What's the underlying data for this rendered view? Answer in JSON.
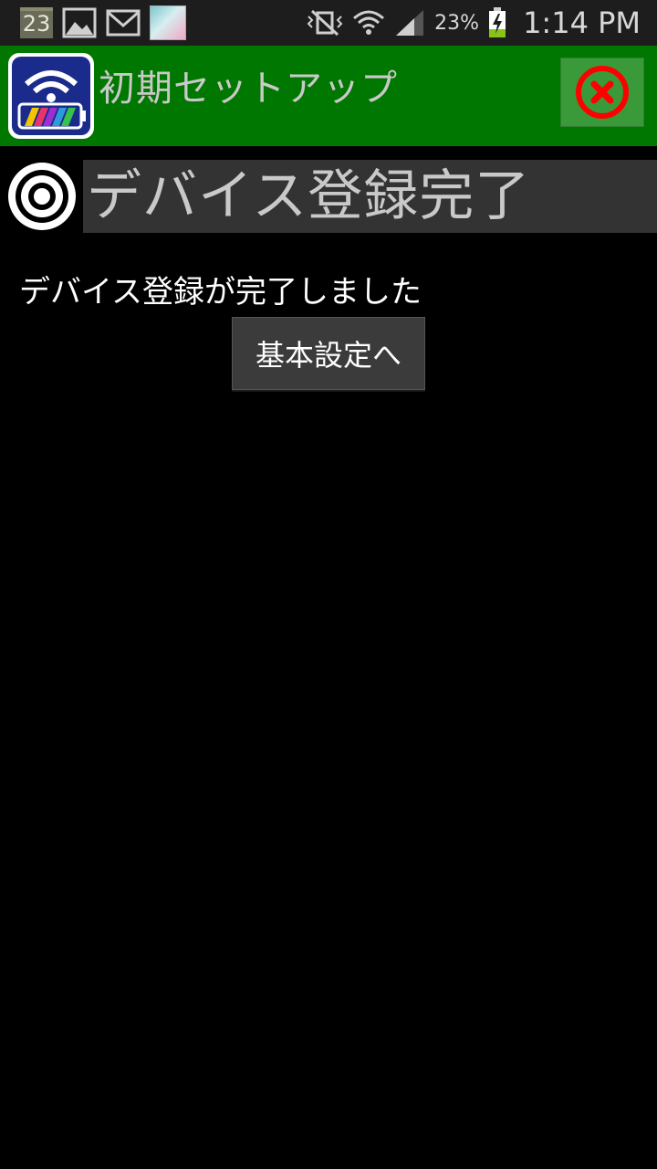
{
  "status_bar": {
    "notification_icons": [
      "calendar-icon",
      "gallery-icon",
      "gmail-icon",
      "app-thumbnail-icon"
    ],
    "calendar_day": "23",
    "battery_percent": "23%",
    "time": "1:14 PM",
    "system_icons": [
      "mute-vibrate-icon",
      "wifi-icon",
      "signal-icon",
      "battery-charging-icon"
    ]
  },
  "header": {
    "title": "初期セットアップ",
    "close_icon": "close-icon",
    "color": "#007700"
  },
  "section": {
    "icon": "target-icon",
    "title": "デバイス登録完了"
  },
  "main": {
    "message": "デバイス登録が完了しました",
    "button_label": "基本設定へ"
  }
}
